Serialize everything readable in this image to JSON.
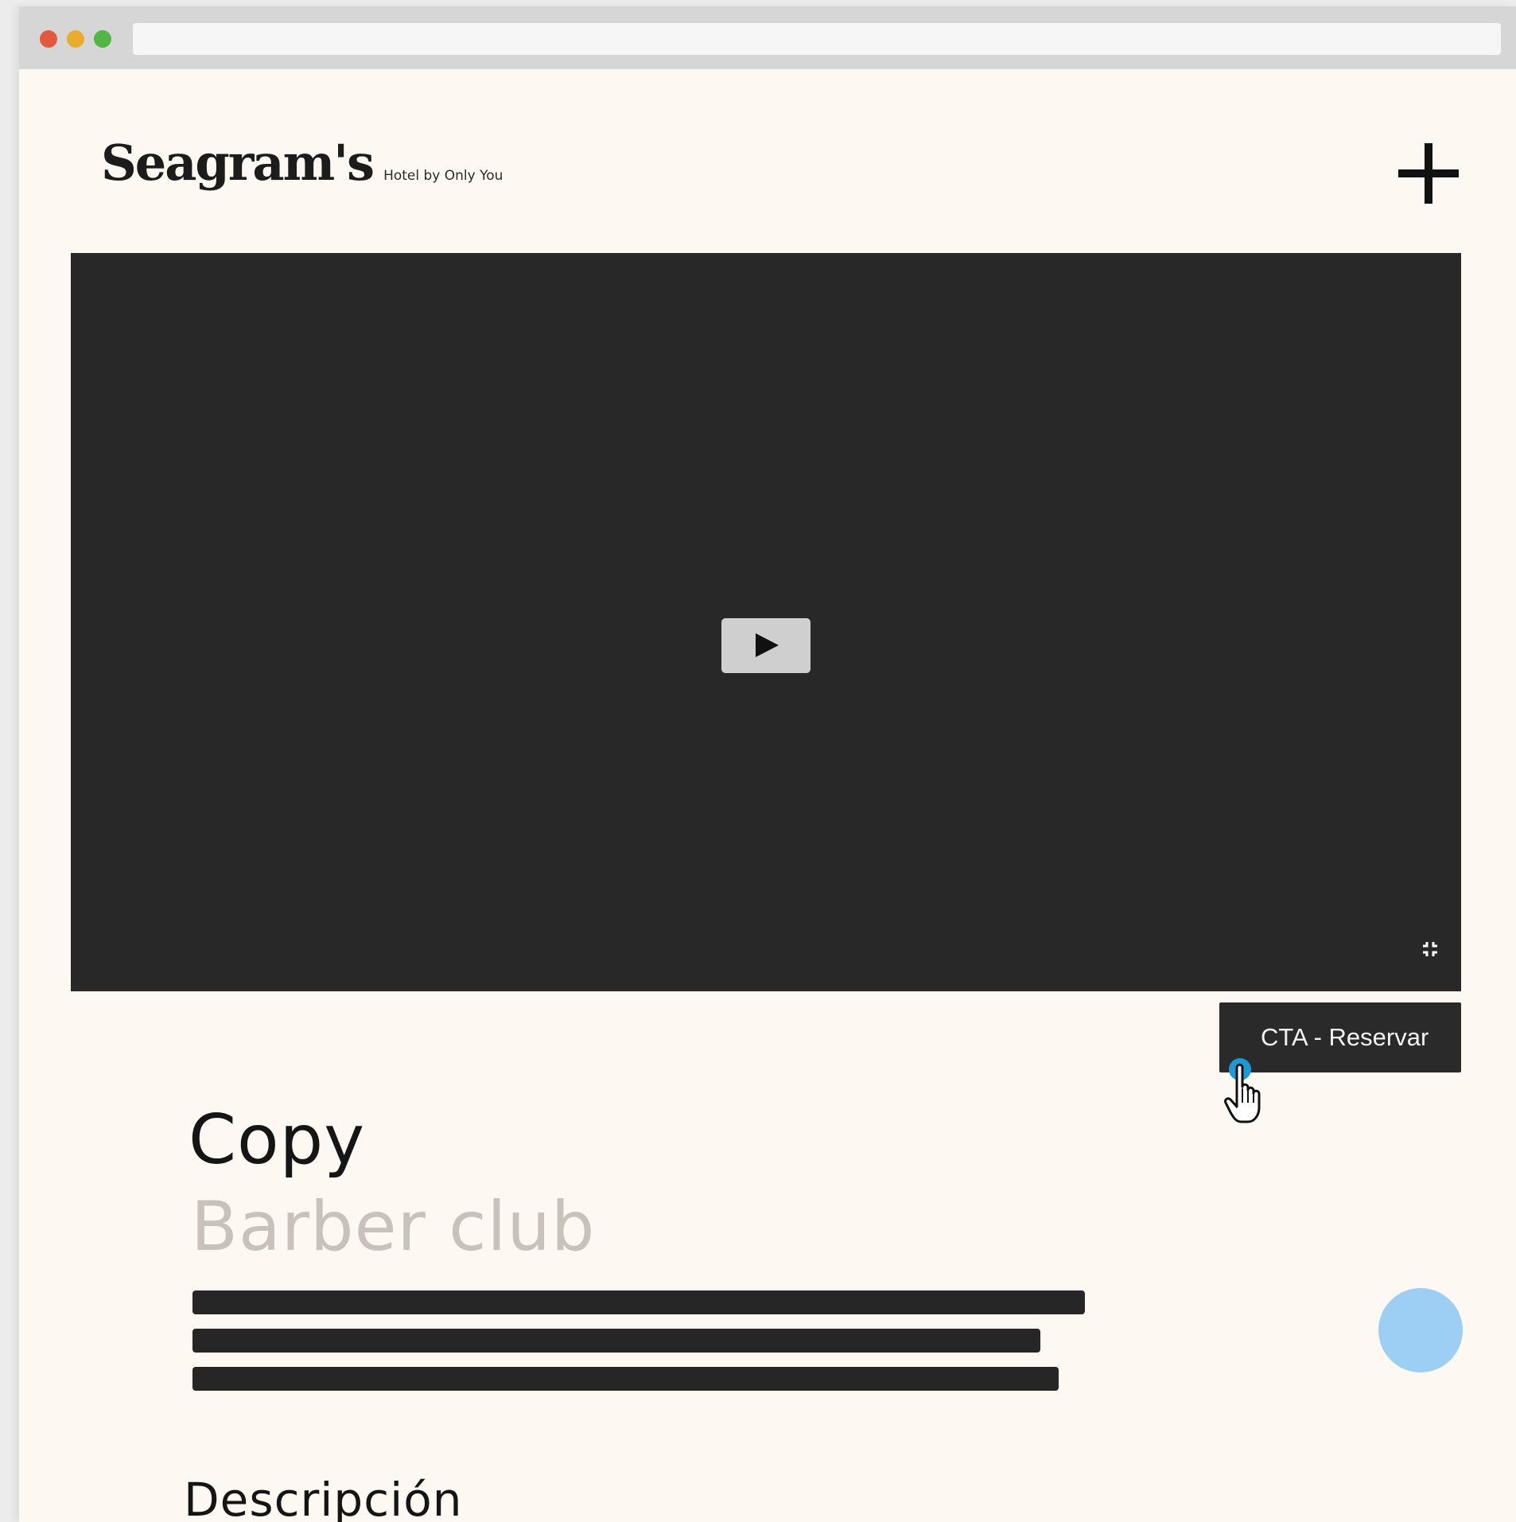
{
  "browser": {
    "traffic_colors": {
      "close": "#e2593e",
      "minimize": "#e9ad2e",
      "maximize": "#52b544"
    },
    "address_value": ""
  },
  "header": {
    "logo_text": "Seagram's",
    "logo_tagline": "Hotel by Only You",
    "menu_icon": "plus-icon"
  },
  "video": {
    "play_icon": "play-icon",
    "fullscreen_icon": "fullscreen-icon"
  },
  "cta": {
    "label": "CTA - Reservar"
  },
  "content": {
    "title": "Copy",
    "subtitle": "Barber club",
    "description_heading": "Descripción"
  },
  "colors": {
    "page_background": "#fdf8f2",
    "video_background": "#282828",
    "cta_background": "#2a2a2a",
    "fab_color": "#9dcff5",
    "subtitle_color": "#c9c2bb",
    "cursor_dot": "#1a9ad6"
  }
}
